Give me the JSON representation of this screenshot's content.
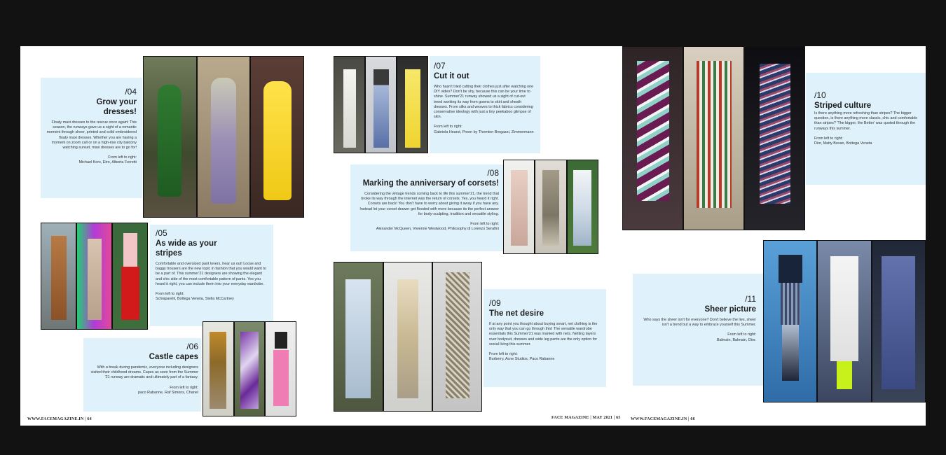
{
  "footer": {
    "left": "WWW.FACEMAGAZINE.IN | 64",
    "center": "FACE MAGAZINE | MAY 2021 | 65",
    "right": "WWW.FACEMAGAZINE.IN | 66"
  },
  "s04": {
    "num": "/04",
    "title": "Grow your dresses!",
    "body": "Floaty maxi dresses to the rescue once again! This season, the runways gave us a sight of a romantic moment through sheer, printed and solid embroidered floaty maxi dresses. Whether you are having a moment on zoom call or on a high-rise city balcony watching sunset, maxi dresses are to go for!",
    "credit_label": "From left to right:",
    "credit": "Michael Kors, Etro, Alberta Ferretti"
  },
  "s05": {
    "num": "/05",
    "title": "As wide as your stripes",
    "body": "Comfortable and oversized pant lovers, hear us out! Loose and baggy trousers are the new topic in fashion that you would want to be a part of. This summer'21 designers are showing the elegant and chic side of the most comfortable pattern of pants. Yes you heard it right, you can include them into your everyday wardrobe.",
    "credit_label": "From left to right:",
    "credit": "Schiaparelli, Bottega Veneta, Stella McCartney"
  },
  "s06": {
    "num": "/06",
    "title": "Castle capes",
    "body": "With a break during pandemic, everyone including designers visited their childhood dreams. Capes as seen from the Summer '21 runway are dramatic and ultimately part of a fantasy.",
    "credit_label": "From left to right:",
    "credit": "paco Rabanne, Raf Simons, Chanel"
  },
  "s07": {
    "num": "/07",
    "title": "Cut it out",
    "body": "Who hasn't tried cutting their clothes just after watching one DIY video? Don't be shy, because this can be your time to shine. Summer'21 runway showed us a sight of cut-out trend working its way from gowns to skirt and sheath dresses. From silks and weaves to thick fabrics considering conservative ideology with just a tiny peekaboo glimpse of skin.",
    "credit_label": "From left to right:",
    "credit": "Gabriela Hearst, Preen by Thornton Bregazzi, Zimmermann"
  },
  "s08": {
    "num": "/08",
    "title": "Marking the anniversary of corsets!",
    "body": "Considering the vintage trends coming back to life this summer'21, the trend that broke its way through the internet was the return of corsets. Yes, you heard it right. Corsets are back! You don't have to worry about giving it away if you have any. Instead let your corset drawer get flooded with more because its the perfect answer for body-sculpting, tradition and versatile styling.",
    "credit_label": "From left to right:",
    "credit": "Alexander McQueen, Vivienne Westwood, Philosophy di Lorenzo Serafini"
  },
  "s09": {
    "num": "/09",
    "title": "The net desire",
    "body": "If at any point you thought about buying smart, net clothing is the only way that you can go through this! The versatile wardrobe essentials this Summer'21 was marked with nets. Netting layers over bodysuit, dresses and wide leg pants are the only option for social living this summer.",
    "credit_label": "From left to right:",
    "credit": "Burberry, Acne Studios, Paco Rabanne"
  },
  "s10": {
    "num": "/10",
    "title": "Striped culture",
    "body": "Is there anything more refreshing than stripes? The bigger question, is there anything more classic, chic and comfortable than stripes? 'The bigger, the Better' was quoted through the runways this summer.",
    "credit_label": "From left to right:",
    "credit": "Dior, Matty Bovan, Bottega Veneta"
  },
  "s11": {
    "num": "/11",
    "title": "Sheer picture",
    "body": "Who says the sheer isn't for everyone? Don't believe the lies, sheer isn't a trend but a way to embrace yourself this Summer.",
    "credit_label": "From left to right:",
    "credit": "Balmain, Balmain, Dior."
  },
  "colors": {
    "box_background": "#dff1fb",
    "page_background": "#ffffff",
    "surround": "#121212"
  }
}
